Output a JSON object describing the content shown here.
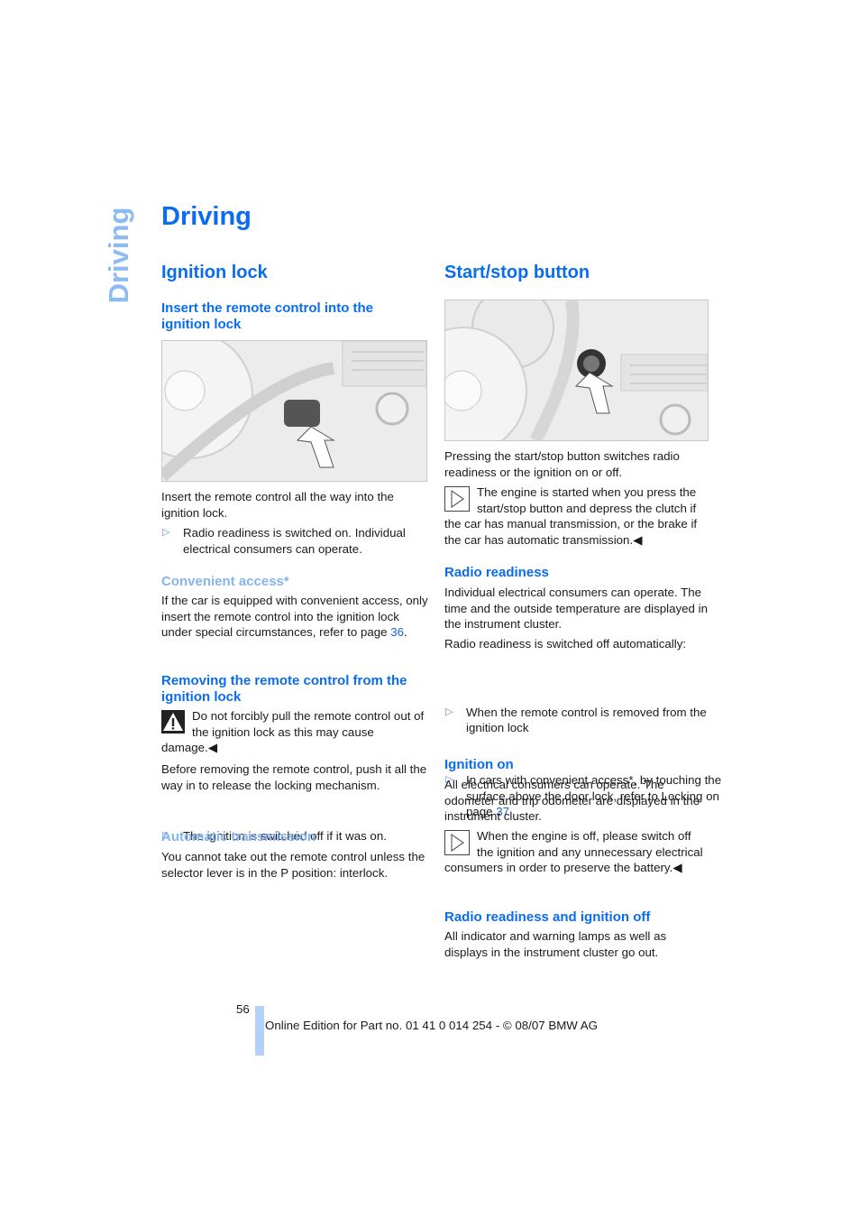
{
  "sidebar": {
    "label": "Driving"
  },
  "title": "Driving",
  "left": {
    "heading": "Ignition lock",
    "insert": {
      "heading": "Insert the remote control into the ignition lock",
      "para": "Insert the remote control all the way into the ignition lock.",
      "bullet": "Radio readiness is switched on. Individual electrical consumers can operate."
    },
    "convenient": {
      "heading": "Convenient access*",
      "para": "If the car is equipped with convenient access, only insert the remote control into the ignition lock under special circumstances, refer to page ",
      "link": "36",
      "end": "."
    },
    "removing": {
      "heading": "Removing the remote control from the ignition lock",
      "warning": "Do not forcibly pull the remote control out of the ignition lock as this may cause damage.◀",
      "para": "Before removing the remote control, push it all the way in to release the locking mechanism.",
      "bullet": "The ignition is switched off if it was on."
    },
    "automatic": {
      "heading": "Automatic transmission",
      "para": "You cannot take out the remote control unless the selector lever is in the P position: interlock."
    }
  },
  "right": {
    "heading": "Start/stop button",
    "para": "Pressing the start/stop button switches radio readiness or the ignition on or off.",
    "note": "The engine is started when you press the start/stop button and depress the clutch if the car has manual transmission, or the brake if the car has automatic transmission.◀",
    "radio": {
      "heading": "Radio readiness",
      "para1": "Individual electrical consumers can operate. The time and the outside temperature are displayed in the instrument cluster.",
      "para2": "Radio readiness is switched off automatically:",
      "bullet1": "When the remote control is removed from the ignition lock",
      "bullet2": "In cars with convenient access*, by touching the surface above the door lock, refer to Locking on page ",
      "bullet2_link": "37"
    },
    "ignition": {
      "heading": "Ignition on",
      "para": "All electrical consumers can operate. The odometer and trip odometer are displayed in the instrument cluster.",
      "note": "When the engine is off, please switch off the ignition and any unnecessary electrical consumers in order to preserve the battery.◀"
    },
    "off": {
      "heading": "Radio readiness and ignition off",
      "para": "All indicator and warning lamps as well as displays in the instrument cluster go out."
    }
  },
  "footer": {
    "page": "56",
    "text": "Online Edition for Part no. 01 41 0 014 254 - © 08/07 BMW AG"
  },
  "colors": {
    "heading": "#0a6cf0",
    "light_heading": "#86b4f0",
    "footer_bar": "#b3d1fb"
  }
}
